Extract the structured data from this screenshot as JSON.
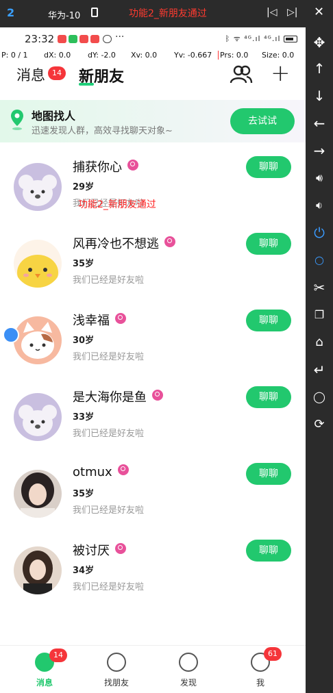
{
  "window": {
    "number": "2",
    "device": "华为-10",
    "title": "功能2_新朋友通过"
  },
  "statusbar": {
    "time": "23:32",
    "right_text": "ᛒ ᯤ ⁴ᴳ.ıl ⁴ᴳ.ıl"
  },
  "debug": {
    "p": "P: 0 / 1",
    "dx": "dX: 0.0",
    "dy": "dY: -2.0",
    "xv": "Xv: 0.0",
    "yv": "Yv: -0.667",
    "prs": "Prs: 0.0",
    "size": "Size: 0.0"
  },
  "header": {
    "tab_messages": "消息",
    "messages_badge": "14",
    "tab_new_friends": "新朋友"
  },
  "banner": {
    "title": "地图找人",
    "subtitle": "迅速发现人群，高效寻找聊天对象~",
    "button": "去试试"
  },
  "overlay_text": "功能2_新朋友通过",
  "friends": [
    {
      "name": "捕获你心",
      "age": "29岁",
      "status": "我们已经是好友啦",
      "chat": "聊聊",
      "avatar": "koala-avatar"
    },
    {
      "name": "风再冷也不想逃",
      "age": "35岁",
      "status": "我们已经是好友啦",
      "chat": "聊聊",
      "avatar": "chick-avatar"
    },
    {
      "name": "浅幸福",
      "age": "30岁",
      "status": "我们已经是好友啦",
      "chat": "聊聊",
      "avatar": "cat-avatar"
    },
    {
      "name": "是大海你是鱼",
      "age": "33岁",
      "status": "我们已经是好友啦",
      "chat": "聊聊",
      "avatar": "koala-avatar"
    },
    {
      "name": "otmux",
      "age": "35岁",
      "status": "我们已经是好友啦",
      "chat": "聊聊",
      "avatar": "photo-avatar"
    },
    {
      "name": "被讨厌",
      "age": "34岁",
      "status": "我们已经是好友啦",
      "chat": "聊聊",
      "avatar": "photo-avatar"
    }
  ],
  "bottom_nav": {
    "messages": "消息",
    "messages_badge": "14",
    "find_friends": "找朋友",
    "discover": "发现",
    "me": "我",
    "me_badge": "61"
  },
  "colors": {
    "accent": "#22c86e",
    "badge": "#f5353a",
    "gender_icon": "#e8519a"
  }
}
